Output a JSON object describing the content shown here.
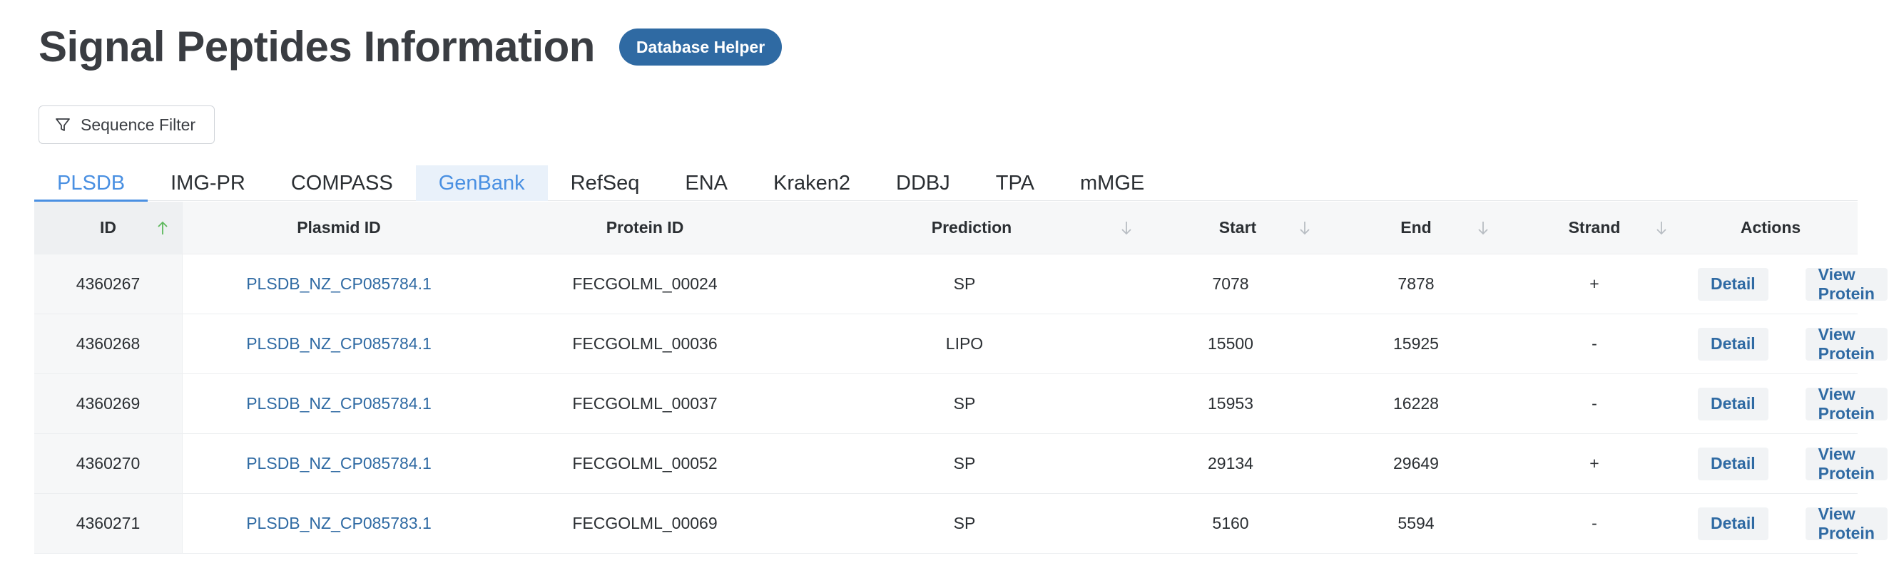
{
  "header": {
    "title": "Signal Peptides Information",
    "helper_button": "Database Helper"
  },
  "filter": {
    "label": "Sequence Filter",
    "icon": "filter-icon"
  },
  "tabs": [
    {
      "label": "PLSDB",
      "state": "active"
    },
    {
      "label": "IMG-PR",
      "state": ""
    },
    {
      "label": "COMPASS",
      "state": ""
    },
    {
      "label": "GenBank",
      "state": "hover"
    },
    {
      "label": "RefSeq",
      "state": ""
    },
    {
      "label": "ENA",
      "state": ""
    },
    {
      "label": "Kraken2",
      "state": ""
    },
    {
      "label": "DDBJ",
      "state": ""
    },
    {
      "label": "TPA",
      "state": ""
    },
    {
      "label": "mMGE",
      "state": ""
    }
  ],
  "table": {
    "columns": {
      "id": "ID",
      "plasmid": "Plasmid ID",
      "protein": "Protein ID",
      "prediction": "Prediction",
      "start": "Start",
      "end": "End",
      "strand": "Strand",
      "actions": "Actions"
    },
    "rows": [
      {
        "id": "4360267",
        "plasmid": "PLSDB_NZ_CP085784.1",
        "protein": "FECGOLML_00024",
        "prediction": "SP",
        "start": "7078",
        "end": "7878",
        "strand": "+",
        "detail": "Detail",
        "view": "View Protein"
      },
      {
        "id": "4360268",
        "plasmid": "PLSDB_NZ_CP085784.1",
        "protein": "FECGOLML_00036",
        "prediction": "LIPO",
        "start": "15500",
        "end": "15925",
        "strand": "-",
        "detail": "Detail",
        "view": "View Protein"
      },
      {
        "id": "4360269",
        "plasmid": "PLSDB_NZ_CP085784.1",
        "protein": "FECGOLML_00037",
        "prediction": "SP",
        "start": "15953",
        "end": "16228",
        "strand": "-",
        "detail": "Detail",
        "view": "View Protein"
      },
      {
        "id": "4360270",
        "plasmid": "PLSDB_NZ_CP085784.1",
        "protein": "FECGOLML_00052",
        "prediction": "SP",
        "start": "29134",
        "end": "29649",
        "strand": "+",
        "detail": "Detail",
        "view": "View Protein"
      },
      {
        "id": "4360271",
        "plasmid": "PLSDB_NZ_CP085783.1",
        "protein": "FECGOLML_00069",
        "prediction": "SP",
        "start": "5160",
        "end": "5594",
        "strand": "-",
        "detail": "Detail",
        "view": "View Protein"
      }
    ]
  },
  "colors": {
    "accent": "#2f6aa3",
    "tab_active": "#4a90e2"
  }
}
